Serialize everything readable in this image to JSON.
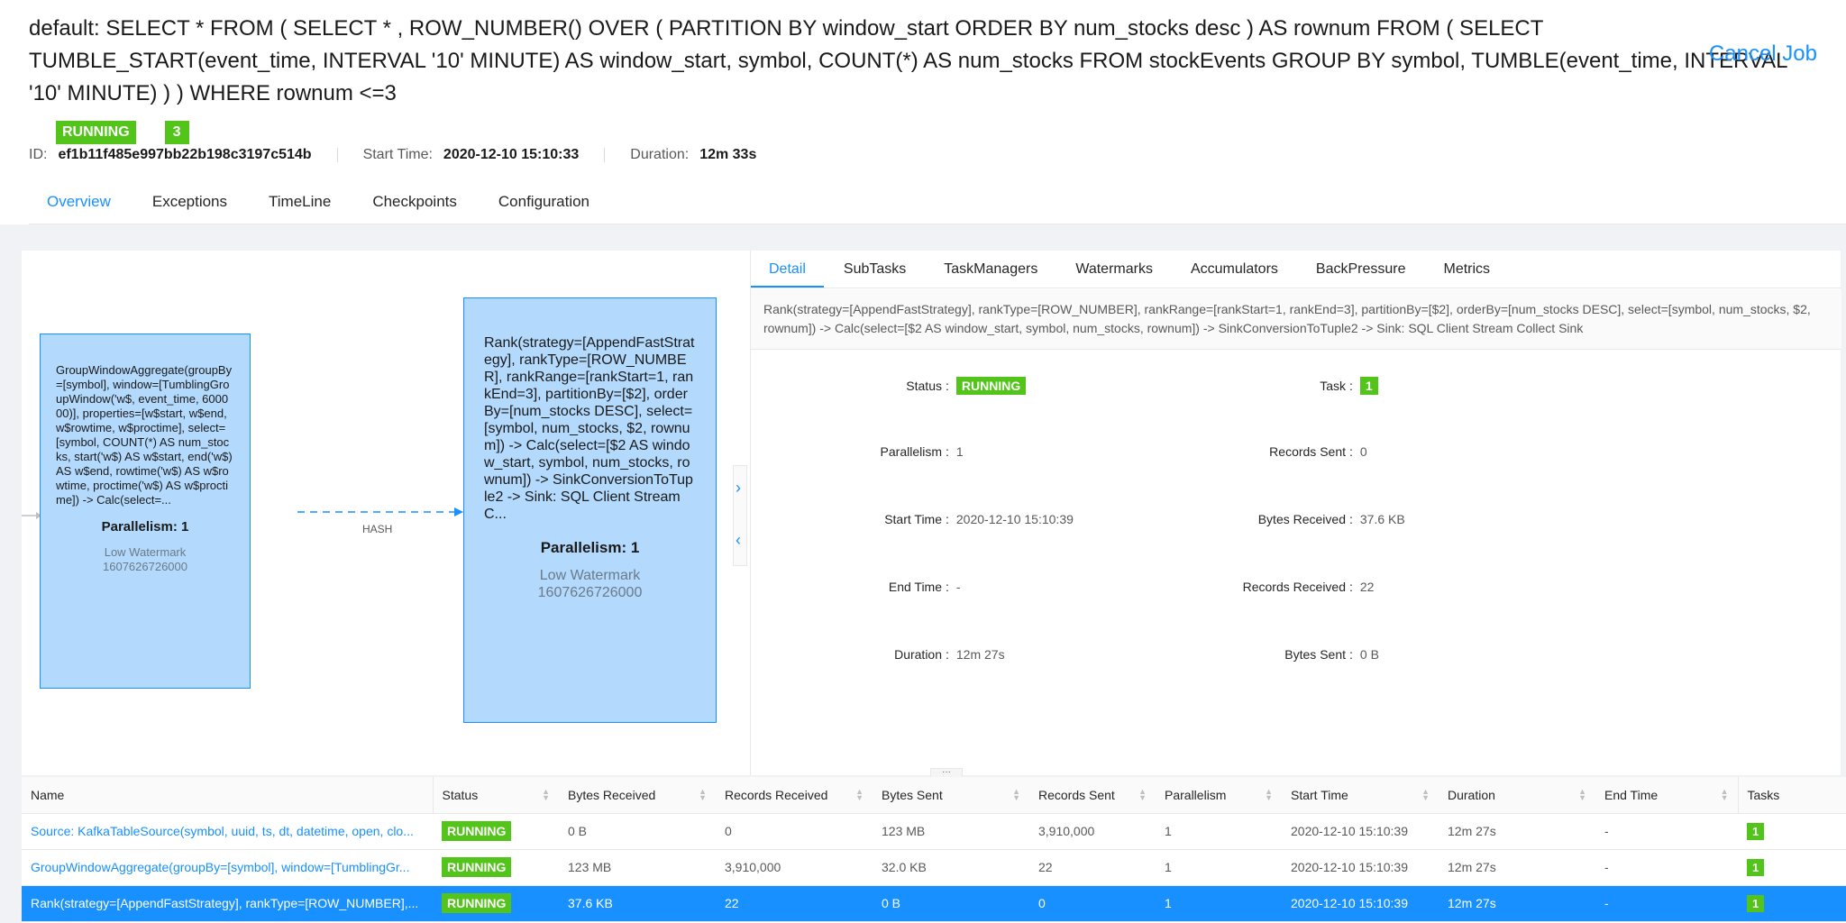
{
  "header": {
    "title": "default: SELECT * FROM ( SELECT * , ROW_NUMBER() OVER ( PARTITION BY window_start ORDER BY num_stocks desc ) AS rownum FROM ( SELECT TUMBLE_START(event_time, INTERVAL '10' MINUTE) AS window_start, symbol, COUNT(*) AS num_stocks FROM stockEvents GROUP BY symbol, TUMBLE(event_time, INTERVAL '10' MINUTE) ) ) WHERE rownum <=3",
    "cancel_label": "Cancel Job",
    "status": "RUNNING",
    "task_count": "3",
    "id_label": "ID:",
    "id_value": "ef1b11f485e997bb22b198c3197c514b",
    "start_label": "Start Time:",
    "start_value": "2020-12-10 15:10:33",
    "duration_label": "Duration:",
    "duration_value": "12m 33s"
  },
  "tabs": [
    "Overview",
    "Exceptions",
    "TimeLine",
    "Checkpoints",
    "Configuration"
  ],
  "graph": {
    "node1": {
      "desc": "GroupWindowAggregate(groupBy=[symbol], window=[TumblingGroupWindow('w$, event_time, 600000)], properties=[w$start, w$end, w$rowtime, w$proctime], select=[symbol, COUNT(*) AS num_stocks, start('w$) AS w$start, end('w$) AS w$end, rowtime('w$) AS w$rowtime, proctime('w$) AS w$proctime]) -> Calc(select=...",
      "parallelism": "Parallelism: 1",
      "wm_label": "Low Watermark",
      "wm_value": "1607626726000"
    },
    "node2": {
      "desc": "Rank(strategy=[AppendFastStrategy], rankType=[ROW_NUMBER], rankRange=[rankStart=1, rankEnd=3], partitionBy=[$2], orderBy=[num_stocks DESC], select=[symbol, num_stocks, $2, rownum]) -> Calc(select=[$2 AS window_start, symbol, num_stocks, rownum]) -> SinkConversionToTuple2 -> Sink: SQL Client Stream C...",
      "parallelism": "Parallelism: 1",
      "wm_label": "Low Watermark",
      "wm_value": "1607626726000"
    },
    "edge_label": "HASH"
  },
  "detail": {
    "tabs": [
      "Detail",
      "SubTasks",
      "TaskManagers",
      "Watermarks",
      "Accumulators",
      "BackPressure",
      "Metrics"
    ],
    "description": "Rank(strategy=[AppendFastStrategy], rankType=[ROW_NUMBER], rankRange=[rankStart=1, rankEnd=3], partitionBy=[$2], orderBy=[num_stocks DESC], select=[symbol, num_stocks, $2, rownum]) -> Calc(select=[$2 AS window_start, symbol, num_stocks, rownum]) -> SinkConversionToTuple2 -> Sink: SQL Client Stream Collect Sink",
    "left": [
      {
        "label": "Status",
        "value": "RUNNING"
      },
      {
        "label": "Parallelism",
        "value": "1"
      },
      {
        "label": "Start Time",
        "value": "2020-12-10 15:10:39"
      },
      {
        "label": "End Time",
        "value": "-"
      },
      {
        "label": "Duration",
        "value": "12m 27s"
      }
    ],
    "right": [
      {
        "label": "Task",
        "value": "1"
      },
      {
        "label": "Records Sent",
        "value": "0"
      },
      {
        "label": "Bytes Received",
        "value": "37.6 KB"
      },
      {
        "label": "Records Received",
        "value": "22"
      },
      {
        "label": "Bytes Sent",
        "value": "0 B"
      }
    ]
  },
  "table": {
    "columns": [
      "Name",
      "Status",
      "Bytes Received",
      "Records Received",
      "Bytes Sent",
      "Records Sent",
      "Parallelism",
      "Start Time",
      "Duration",
      "End Time",
      "Tasks"
    ],
    "rows": [
      {
        "name": "Source: KafkaTableSource(symbol, uuid, ts, dt, datetime, open, clo...",
        "status": "RUNNING",
        "bytes_received": "0 B",
        "records_received": "0",
        "bytes_sent": "123 MB",
        "records_sent": "3,910,000",
        "parallelism": "1",
        "start_time": "2020-12-10 15:10:39",
        "duration": "12m 27s",
        "end_time": "-",
        "tasks": "1"
      },
      {
        "name": "GroupWindowAggregate(groupBy=[symbol], window=[TumblingGr...",
        "status": "RUNNING",
        "bytes_received": "123 MB",
        "records_received": "3,910,000",
        "bytes_sent": "32.0 KB",
        "records_sent": "22",
        "parallelism": "1",
        "start_time": "2020-12-10 15:10:39",
        "duration": "12m 27s",
        "end_time": "-",
        "tasks": "1"
      },
      {
        "name": "Rank(strategy=[AppendFastStrategy], rankType=[ROW_NUMBER],...",
        "status": "RUNNING",
        "bytes_received": "37.6 KB",
        "records_received": "22",
        "bytes_sent": "0 B",
        "records_sent": "0",
        "parallelism": "1",
        "start_time": "2020-12-10 15:10:39",
        "duration": "12m 27s",
        "end_time": "-",
        "tasks": "1"
      }
    ]
  },
  "colors": {
    "accent": "#1890ff",
    "running": "#52c41a",
    "node_fill": "#b3d9fd"
  }
}
